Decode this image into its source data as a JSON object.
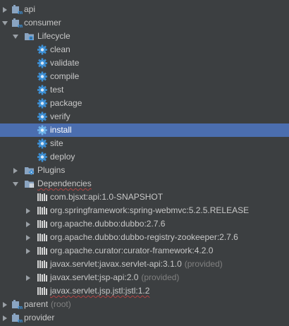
{
  "tree": {
    "api": {
      "label": "api",
      "icon": "maven-module-icon",
      "expanded": false
    },
    "consumer": {
      "label": "consumer",
      "icon": "maven-module-icon",
      "expanded": true
    },
    "lifecycle": {
      "label": "Lifecycle",
      "icon": "folder-lifecycle-icon",
      "expanded": true,
      "goals": [
        {
          "label": "clean",
          "icon": "gear-icon"
        },
        {
          "label": "validate",
          "icon": "gear-icon"
        },
        {
          "label": "compile",
          "icon": "gear-icon"
        },
        {
          "label": "test",
          "icon": "gear-icon"
        },
        {
          "label": "package",
          "icon": "gear-icon"
        },
        {
          "label": "verify",
          "icon": "gear-icon"
        },
        {
          "label": "install",
          "icon": "gear-icon",
          "selected": true
        },
        {
          "label": "site",
          "icon": "gear-icon"
        },
        {
          "label": "deploy",
          "icon": "gear-icon"
        }
      ]
    },
    "plugins": {
      "label": "Plugins",
      "icon": "folder-plugins-icon",
      "expanded": false
    },
    "dependencies": {
      "label": "Dependencies",
      "icon": "folder-dependencies-icon",
      "expanded": true,
      "items": [
        {
          "label": "com.bjsxt:api:1.0-SNAPSHOT",
          "suffix": "",
          "expandable": false
        },
        {
          "label": "org.springframework:spring-webmvc:5.2.5.RELEASE",
          "suffix": "",
          "expandable": true
        },
        {
          "label": "org.apache.dubbo:dubbo:2.7.6",
          "suffix": "",
          "expandable": true
        },
        {
          "label": "org.apache.dubbo:dubbo-registry-zookeeper:2.7.6",
          "suffix": "",
          "expandable": true
        },
        {
          "label": "org.apache.curator:curator-framework:4.2.0",
          "suffix": "",
          "expandable": true
        },
        {
          "label": "javax.servlet:javax.servlet-api:3.1.0",
          "suffix": "(provided)",
          "expandable": false
        },
        {
          "label": "javax.servlet:jsp-api:2.0",
          "suffix": "(provided)",
          "expandable": true
        },
        {
          "label": "javax.servlet.jsp.jstl:jstl:1.2",
          "suffix": "",
          "expandable": false
        }
      ]
    },
    "parent": {
      "label": "parent",
      "suffix": "(root)",
      "icon": "maven-module-icon",
      "expanded": false
    },
    "provider": {
      "label": "provider",
      "icon": "maven-module-icon",
      "expanded": false
    }
  },
  "colors": {
    "background": "#3c3f41",
    "selection": "#4b6eaf",
    "text": "#c8c8c8",
    "muted_text": "#808080",
    "gear_blue": "#3d8fd4",
    "error_underline": "#b34141"
  }
}
